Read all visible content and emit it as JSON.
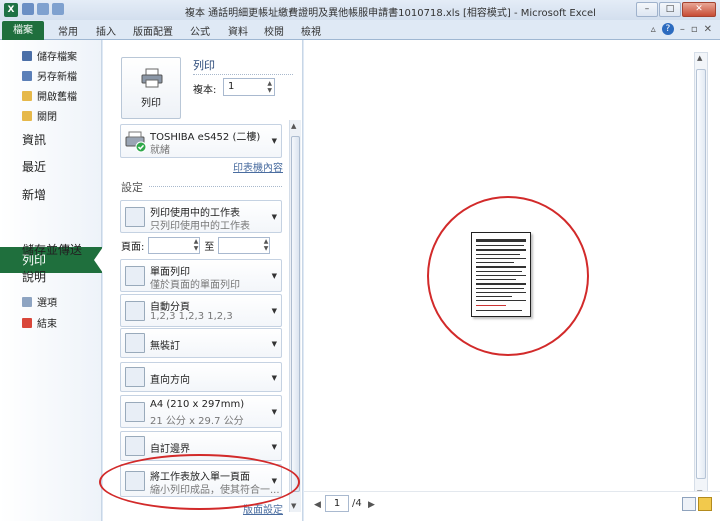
{
  "window": {
    "title": "複本 通話明細更帳址繳費證明及異他帳服申請書1010718.xls [相容模式] - Microsoft Excel",
    "controls": {
      "minimize": "–",
      "maximize": "□",
      "close": "✕"
    }
  },
  "ribbon": {
    "file_tab": "檔案",
    "tabs": [
      "常用",
      "插入",
      "版面配置",
      "公式",
      "資料",
      "校閱",
      "檢視"
    ]
  },
  "nav": {
    "quick_items": [
      "儲存檔案",
      "另存新檔",
      "開啟舊檔",
      "關閉"
    ],
    "items": [
      "資訊",
      "最近",
      "新增",
      "列印",
      "儲存並傳送",
      "說明"
    ],
    "active": "列印",
    "bottom_items": [
      "選項",
      "結束"
    ]
  },
  "print": {
    "button_label": "列印",
    "heading": "列印",
    "copies_label": "複本:",
    "copies_value": "1"
  },
  "printer": {
    "name": "TOSHIBA eS452 (二樓)",
    "status": "就緒",
    "properties_link": "印表機內容"
  },
  "settings": {
    "heading": "設定",
    "pages_label": "頁面:",
    "to_label": "至",
    "page_setup_link": "版面設定",
    "options": [
      {
        "line1": "列印使用中的工作表",
        "line2": "只列印使用中的工作表",
        "icon": "sheets-icon"
      },
      {
        "line1": "單面列印",
        "line2": "僅於頁面的單面列印",
        "icon": "single-side-icon"
      },
      {
        "line1": "自動分頁",
        "line2": "1,2,3    1,2,3    1,2,3",
        "icon": "collate-icon"
      },
      {
        "line1": "無裝訂",
        "line2": "",
        "icon": "staple-icon"
      },
      {
        "line1": "直向方向",
        "line2": "",
        "icon": "portrait-icon"
      },
      {
        "line1": "A4 (210 x 297mm)",
        "line2": "21 公分 x 29.7 公分",
        "icon": "paper-size-icon"
      },
      {
        "line1": "自訂邊界",
        "line2": "",
        "icon": "margins-icon"
      },
      {
        "line1": "將工作表放入單一頁面",
        "line2": "縮小列印成品，使其符合一...",
        "icon": "fit-to-page-icon"
      }
    ]
  },
  "preview": {
    "current_page": "1",
    "total_pages": "/4"
  }
}
